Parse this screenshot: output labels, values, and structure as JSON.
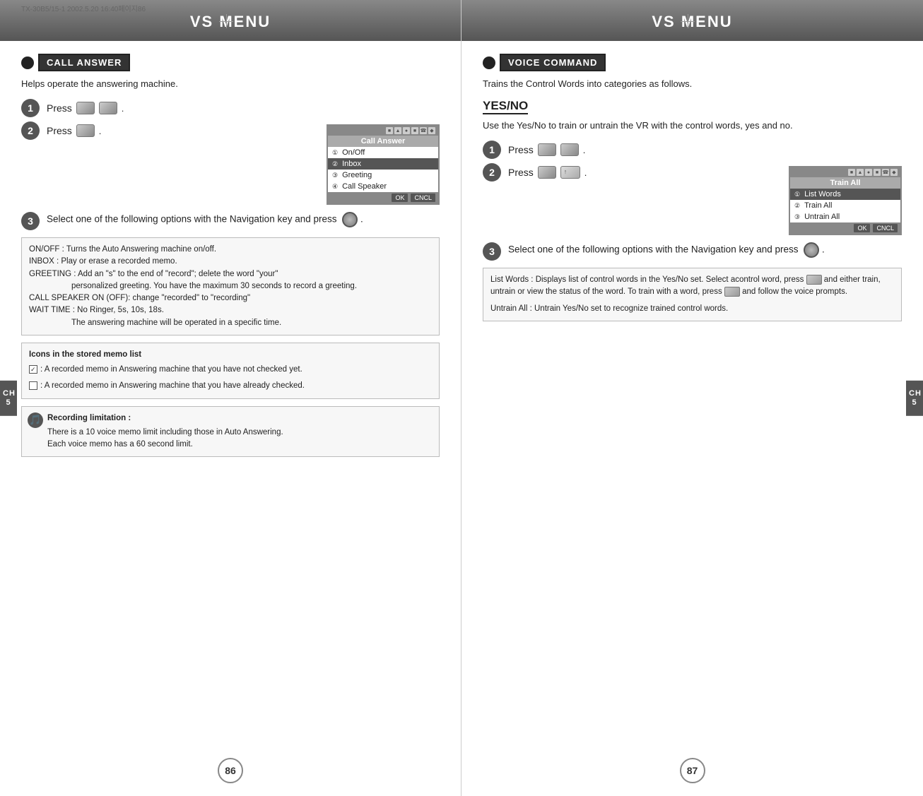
{
  "left": {
    "header": "VS MENU",
    "section_title": "CALL ANSWER",
    "section_desc": "Helps operate the answering machine.",
    "steps": [
      {
        "num": "1",
        "text": "Press",
        "buttons": [
          "round",
          "round2"
        ]
      },
      {
        "num": "2",
        "text": "Press",
        "buttons": [
          "rect"
        ]
      }
    ],
    "menu_screen": {
      "title": "Call Answer",
      "items": [
        {
          "num": "1",
          "label": "On/Off",
          "selected": false
        },
        {
          "num": "2",
          "label": "Inbox",
          "selected": true
        },
        {
          "num": "3",
          "label": "Greeting",
          "selected": false
        },
        {
          "num": "4",
          "label": "Call Speaker",
          "selected": false
        }
      ],
      "footer": [
        "OK",
        "CNCL"
      ]
    },
    "step3_text": "Select one of the following options with the Navigation key and press",
    "info_box": {
      "lines": [
        "ON/OFF : Turns the Auto Answering machine on/off.",
        "INBOX : Play or erase a recorded memo.",
        "GREETING : Add an \"s\" to the end of \"record\"; delete the word \"your\"",
        "personalized greeting. You have the maximum 30 seconds to record a greeting.",
        "CALL SPEAKER ON (OFF): change \"recorded\" to \"recording\"",
        "WAIT TIME : No Ringer, 5s, 10s, 18s.",
        "The answering machine will be operated in a specific time."
      ]
    },
    "icons_box": {
      "title": "Icons in the stored memo list",
      "items": [
        {
          "checked": true,
          "text": ": A recorded memo in Answering machine that you have not checked yet."
        },
        {
          "checked": false,
          "text": ": A recorded memo in Answering machine that you have already checked."
        }
      ]
    },
    "note_box": {
      "title": "Recording limitation :",
      "lines": [
        "There is a 10 voice memo limit including those in Auto Answering.",
        "Each voice memo has a 60 second limit."
      ]
    },
    "page_num": "86",
    "chapter": "CH\n5",
    "doc_info": "TX-30B5/15-1  2002.5.20  16:40페이지86"
  },
  "right": {
    "header": "VS MENU",
    "section_title": "VOICE COMMAND",
    "section_desc": "Trains the Control Words into categories as follows.",
    "subsection_title": "YES/NO",
    "subsection_desc": "Use the Yes/No to train or untrain the VR with the control words, yes and no.",
    "steps": [
      {
        "num": "1",
        "text": "Press",
        "buttons": [
          "round",
          "round2"
        ]
      },
      {
        "num": "2",
        "text": "Press",
        "buttons": [
          "round3",
          "round4"
        ]
      }
    ],
    "menu_screen": {
      "title": "Train All",
      "items": [
        {
          "num": "1",
          "label": "List Words",
          "selected": true
        },
        {
          "num": "2",
          "label": "Train All",
          "selected": false
        },
        {
          "num": "3",
          "label": "Untrain All",
          "selected": false
        }
      ],
      "footer": [
        "OK",
        "CNCL"
      ]
    },
    "step3_text": "Select one of the following options with the Navigation key and press",
    "info_box": {
      "lines": [
        "List Words : Displays list of control words in the Yes/No set. Select acontrol word, press  and either train, untrain or view the status of the word. To train with a word, press  and follow the voice prompts.",
        "Untrain All : Untrain Yes/No set to recognize trained control words."
      ]
    },
    "page_num": "87",
    "chapter": "CH\n5"
  }
}
